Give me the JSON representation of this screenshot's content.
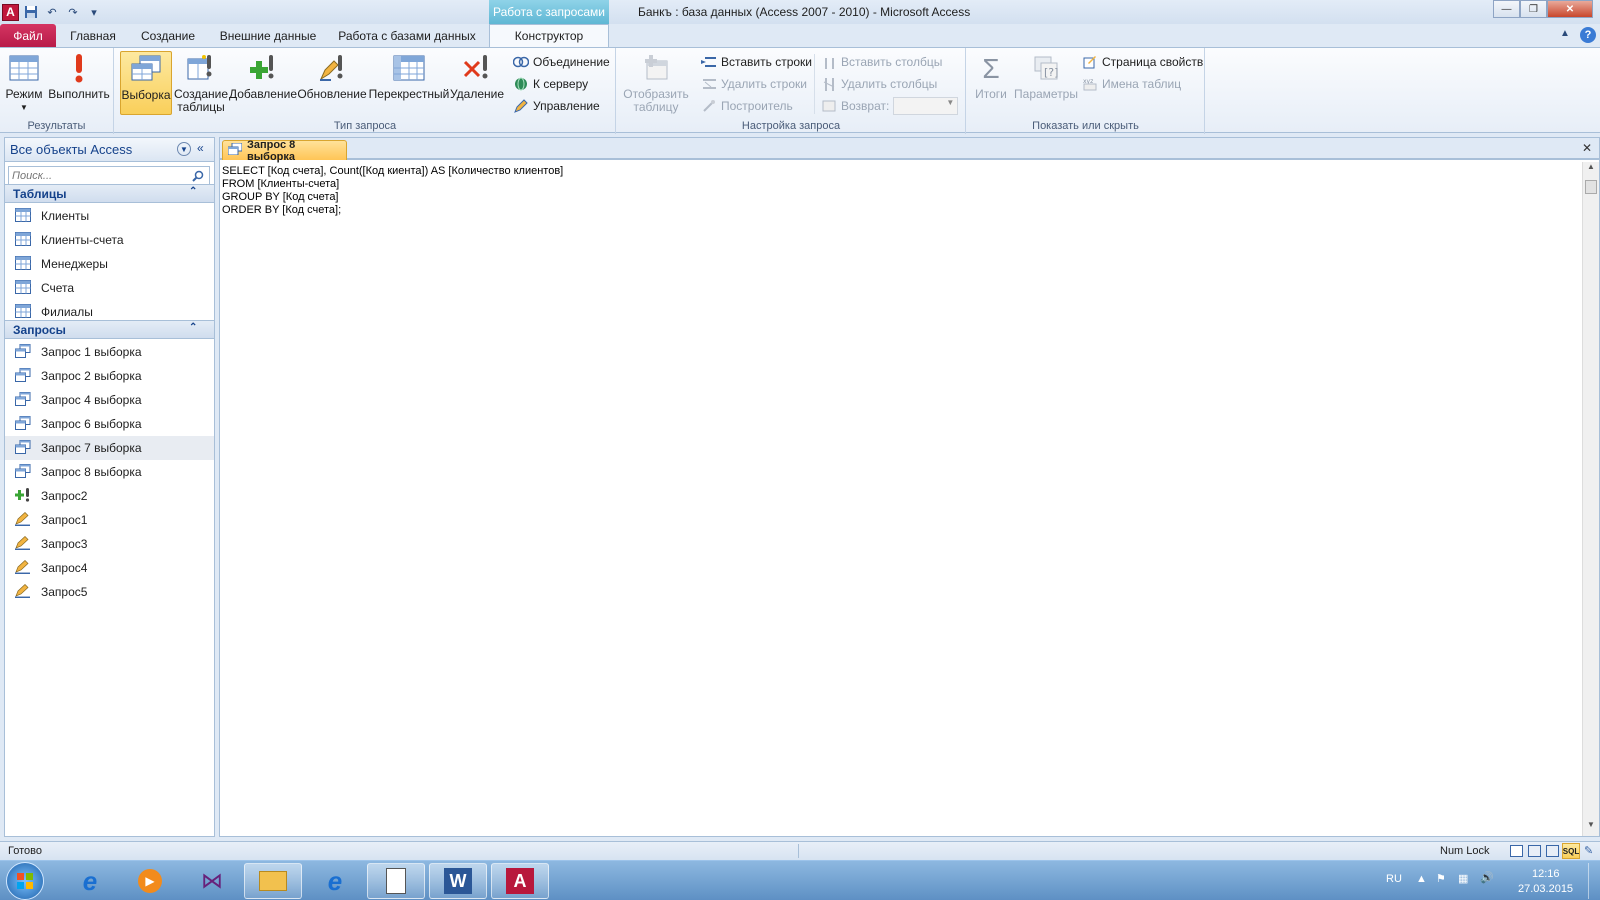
{
  "window": {
    "title": "Банкъ : база данных (Access 2007 - 2010)  -  Microsoft Access",
    "context_tab_title": "Работа с запросами",
    "controls": {
      "minimize": "—",
      "restore": "❐",
      "close": "✕"
    }
  },
  "qat": {
    "save": "💾",
    "undo": "↶",
    "redo": "↷",
    "customize": "▾",
    "app_letter": "A"
  },
  "tabs": [
    {
      "label": "Файл"
    },
    {
      "label": "Главная"
    },
    {
      "label": "Создание"
    },
    {
      "label": "Внешние данные"
    },
    {
      "label": "Работа с базами данных"
    },
    {
      "label": "Конструктор"
    }
  ],
  "ribbon": {
    "results": {
      "label": "Результаты",
      "mode": "Режим",
      "run": "Выполнить"
    },
    "query_type": {
      "label": "Тип запроса",
      "select": "Выборка",
      "make_table_1": "Создание",
      "make_table_2": "таблицы",
      "append": "Добавление",
      "update": "Обновление",
      "crosstab": "Перекрестный",
      "delete": "Удаление",
      "union": "Объединение",
      "pass_through": "К серверу",
      "data_definition": "Управление"
    },
    "setup": {
      "label": "Настройка запроса",
      "show_table_1": "Отобразить",
      "show_table_2": "таблицу",
      "insert_rows": "Вставить строки",
      "delete_rows": "Удалить строки",
      "builder": "Построитель",
      "insert_cols": "Вставить столбцы",
      "delete_cols": "Удалить столбцы",
      "return": "Возврат:"
    },
    "show_hide": {
      "label": "Показать или скрыть",
      "totals": "Итоги",
      "params": "Параметры",
      "property_sheet": "Страница свойств",
      "table_names": "Имена таблиц"
    }
  },
  "nav": {
    "header": "Все объекты Access",
    "search_placeholder": "Поиск...",
    "tables_label": "Таблицы",
    "tables": [
      "Клиенты",
      "Клиенты-счета",
      "Менеджеры",
      "Счета",
      "Филиалы"
    ],
    "queries_label": "Запросы",
    "queries": [
      {
        "label": "Запрос 1 выборка",
        "kind": "select"
      },
      {
        "label": "Запрос 2 выборка",
        "kind": "select"
      },
      {
        "label": "Запрос 4 выборка",
        "kind": "select"
      },
      {
        "label": "Запрос 6 выборка",
        "kind": "select"
      },
      {
        "label": "Запрос 7 выборка",
        "kind": "select"
      },
      {
        "label": "Запрос 8 выборка",
        "kind": "select"
      },
      {
        "label": "Запрос2",
        "kind": "append"
      },
      {
        "label": "Запрос1",
        "kind": "update"
      },
      {
        "label": "Запрос3",
        "kind": "update"
      },
      {
        "label": "Запрос4",
        "kind": "update"
      },
      {
        "label": "Запрос5",
        "kind": "update"
      }
    ]
  },
  "document": {
    "tab_label": "Запрос 8 выборка",
    "sql": "SELECT [Код счета], Count([Код киента]) AS [Количество клиентов]\nFROM [Клиенты-счета]\nGROUP BY [Код счета]\nORDER BY [Код счета];"
  },
  "status": {
    "ready": "Готово",
    "num_lock": "Num Lock",
    "sql_view": "SQL"
  },
  "tray": {
    "lang": "RU",
    "time": "12:16",
    "date": "27.03.2015"
  },
  "colors": {
    "accent": "#c0183c",
    "context": "#5fb7d4",
    "active_button": "#f9cf5a"
  }
}
